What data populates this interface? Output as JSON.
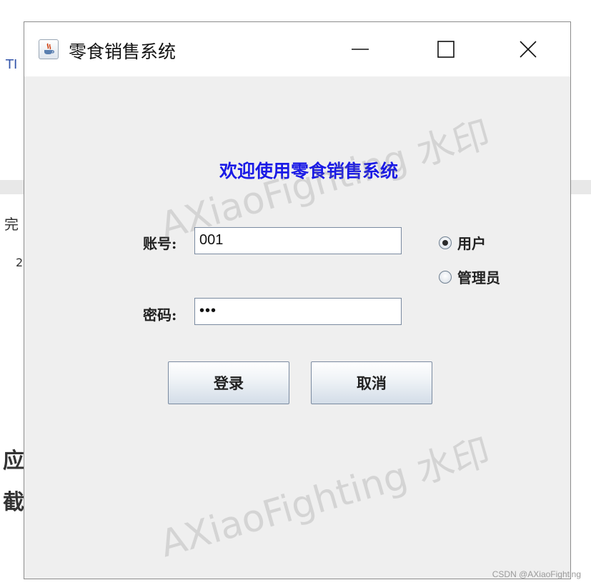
{
  "background": {
    "fragments": [
      "TI",
      "完",
      "2",
      "应",
      "截"
    ]
  },
  "window": {
    "title": "零食销售系统",
    "app_icon": "java-cup-icon",
    "controls": [
      "minimize-icon",
      "maximize-icon",
      "close-icon"
    ]
  },
  "login": {
    "welcome": "欢迎使用零食销售系统",
    "account_label": "账号:",
    "account_value": "001",
    "password_label": "密码:",
    "password_mask": "•••",
    "role_options": [
      {
        "label": "用户",
        "selected": true
      },
      {
        "label": "管理员",
        "selected": false
      }
    ],
    "login_button": "登录",
    "cancel_button": "取消"
  },
  "watermark": {
    "text": "AXiaoFighting 水印",
    "footer": "CSDN @AXiaoFighting"
  }
}
